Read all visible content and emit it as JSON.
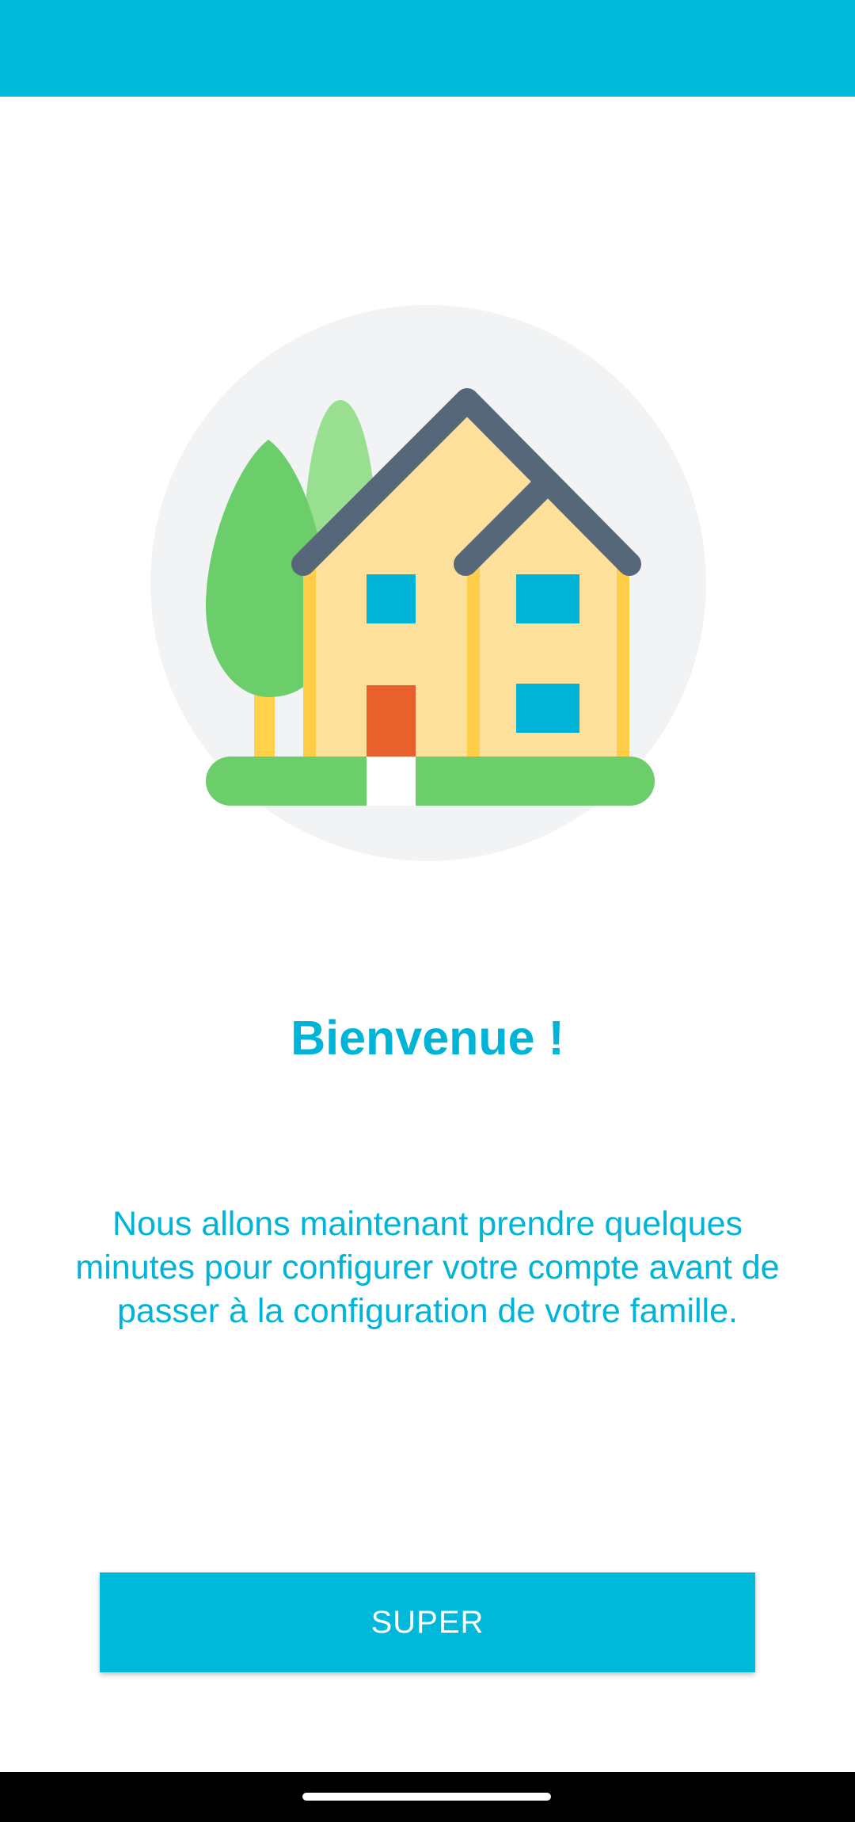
{
  "colors": {
    "accent": "#00b4d8",
    "status_bar": "#00b8d9",
    "button_bg": "#00b8d9",
    "button_text": "#ffffff"
  },
  "illustration": {
    "icon": "house-with-trees-illustration"
  },
  "welcome": {
    "title": "Bienvenue !",
    "message": "Nous allons maintenant prendre quelques minutes pour configurer votre compte avant de passer à la configuration de votre famille."
  },
  "actions": {
    "primary_label": "SUPER"
  }
}
